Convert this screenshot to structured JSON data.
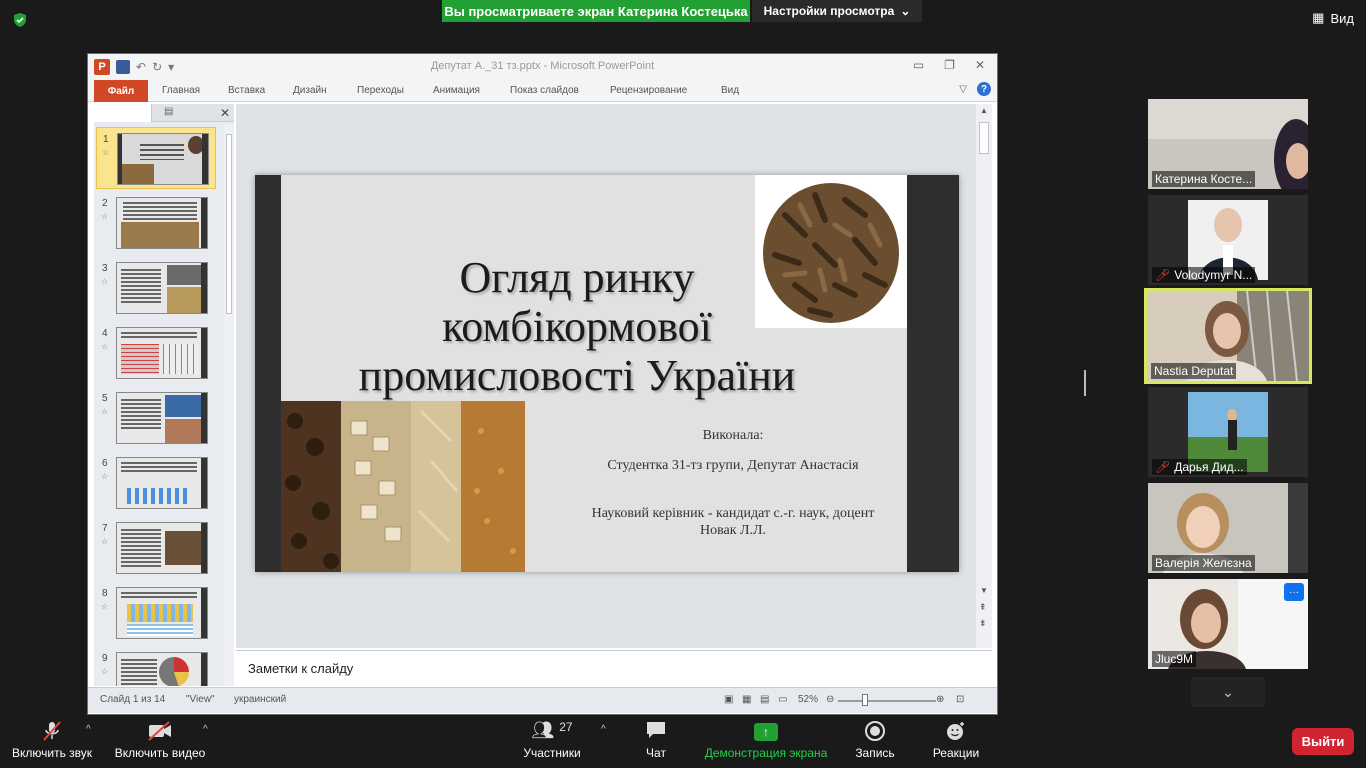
{
  "zoom": {
    "share_banner": "Вы просматриваете экран Катерина Костецька",
    "view_settings": "Настройки просмотра",
    "view_button": "Вид",
    "leave_button": "Выйти",
    "toolbar": {
      "audio": "Включить звук",
      "video": "Включить видео",
      "participants": "Участники",
      "participants_count": "27",
      "chat": "Чат",
      "share": "Демонстрация экрана",
      "record": "Запись",
      "reactions": "Реакции"
    },
    "participants": [
      {
        "name": "Катерина Косте...",
        "muted": false
      },
      {
        "name": "Volodymyr N...",
        "muted": true
      },
      {
        "name": "Nastia Deputat",
        "muted": false
      },
      {
        "name": "Дарья  Дид...",
        "muted": true
      },
      {
        "name": "Валерія Желєзна",
        "muted": false
      },
      {
        "name": "Jluc9M",
        "muted": false
      }
    ],
    "colors": {
      "share_green": "#23a034",
      "leave_red": "#d02430",
      "speaker_border": "#d6e85c"
    }
  },
  "ppt": {
    "window_title": "Депутат А._31 тз.pptx - Microsoft PowerPoint",
    "file_tab": "Файл",
    "tabs": [
      "Главная",
      "Вставка",
      "Дизайн",
      "Переходы",
      "Анимация",
      "Показ слайдов",
      "Рецензирование",
      "Вид"
    ],
    "thumb_numbers": [
      "1",
      "2",
      "3",
      "4",
      "5",
      "6",
      "7",
      "8",
      "9"
    ],
    "slide": {
      "title_lines": [
        "Огляд ринку",
        "комбікормової",
        "промисловості України"
      ],
      "author_label": "Виконала:",
      "author": "Студентка 31-тз групи, Депутат Анастасія",
      "supervisor": "Науковий керівник - кандидат с.-г. наук, доцент Новак Л.Л."
    },
    "notes_placeholder": "Заметки к слайду",
    "status": {
      "slide_counter": "Слайд 1 из 14",
      "theme": "\"View\"",
      "language": "украинский",
      "zoom": "52%"
    }
  }
}
